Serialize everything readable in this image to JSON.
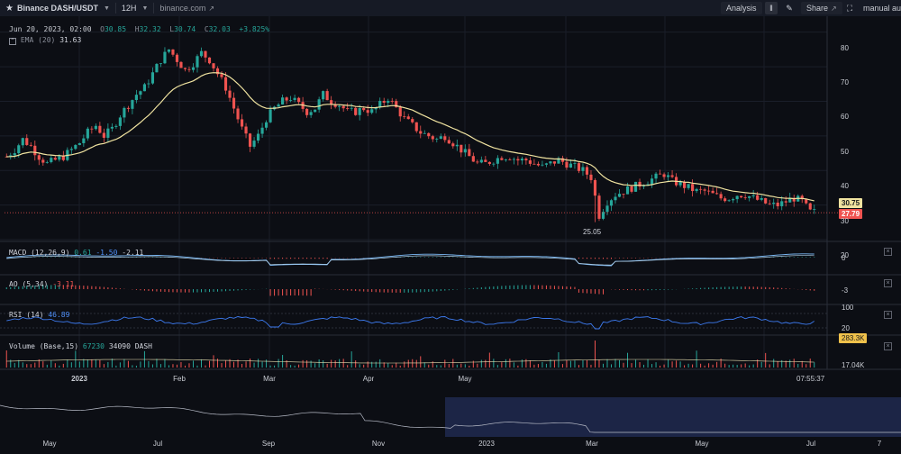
{
  "toolbar": {
    "symbol": "Binance DASH/USDT",
    "interval": "12H",
    "source": "binance.com",
    "analysis": "Analysis",
    "share": "Share",
    "mode": "manual",
    "overflow": "au"
  },
  "legend": {
    "date": "Jun 20, 2023, 02:00",
    "o_label": "O",
    "o": "30.85",
    "h_label": "H",
    "h": "32.32",
    "l_label": "L",
    "l": "30.74",
    "c_label": "C",
    "c": "32.03",
    "change": "+3.825%",
    "ema_label": "EMA (20)",
    "ema": "31.63"
  },
  "panes": {
    "macd": {
      "label": "MACD (12,26,9)",
      "v1": "0.61",
      "v2": "-1.50",
      "v3": "-2.11",
      "axis": "0"
    },
    "ao": {
      "label": "AO (5,34)",
      "v1": "-3.11",
      "axis": "-3"
    },
    "rsi": {
      "label": "RSI (14)",
      "v1": "46.89",
      "axis_top": "100",
      "axis_mid": "20"
    },
    "volume": {
      "label": "Volume (Base,15)",
      "v1": "67230",
      "v2": "34090 DASH",
      "axis": "17.04K",
      "badge": "283.3K"
    }
  },
  "price_axis": [
    "80",
    "70",
    "60",
    "50",
    "40",
    "30",
    "20"
  ],
  "price_badges": {
    "ema": "30.75",
    "last": "27.79"
  },
  "low_marker": "25.05",
  "time_axis": [
    "2023",
    "Feb",
    "Mar",
    "Apr",
    "May"
  ],
  "time_readout": "07:55:37",
  "navigator_axis": [
    "May",
    "Jul",
    "Sep",
    "Nov",
    "2023",
    "Mar",
    "May",
    "Jul",
    "7"
  ],
  "colors": {
    "up": "#26a69a",
    "down": "#ef5350",
    "ema": "#f0e3a0",
    "rsi": "#3d7bf0",
    "macd": "#7ab8f5",
    "signal": "#b0d0e8",
    "navigator_selection": "#1c2546"
  },
  "chart_data": {
    "type": "candlestick",
    "series_note": "approximate DASH/USDT closing path (12H), Jan–Jun 2023",
    "closes": [
      44,
      46,
      49,
      47,
      44,
      42,
      43,
      44,
      46,
      48,
      51,
      53,
      50,
      52,
      56,
      59,
      62,
      64,
      68,
      72,
      75,
      72,
      69,
      71,
      74,
      72,
      68,
      64,
      58,
      52,
      47,
      50,
      55,
      58,
      60,
      61,
      59,
      57,
      58,
      62,
      60,
      59,
      57,
      57,
      58,
      57,
      59,
      61,
      58,
      55,
      53,
      51,
      50,
      49,
      50,
      48,
      46,
      44,
      42,
      42,
      43,
      44,
      44,
      43,
      43,
      42,
      41,
      42,
      43,
      42,
      41,
      40,
      38,
      27,
      31,
      33,
      34,
      35,
      36,
      37,
      38,
      39,
      37,
      36,
      35,
      34,
      34,
      33,
      32,
      32,
      33,
      33,
      32,
      31,
      30,
      30,
      31,
      32,
      31,
      28
    ],
    "low_value": 25.05,
    "last_price": 27.79,
    "ema_value": 30.75,
    "ylim": [
      20,
      82
    ]
  }
}
